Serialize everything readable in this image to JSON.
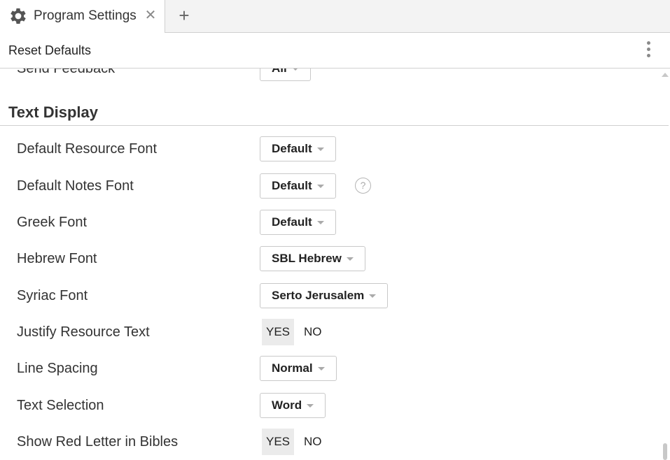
{
  "tab": {
    "title": "Program Settings",
    "close_symbol": "✕",
    "gear_icon": "gear-icon",
    "new_tab_symbol": "+"
  },
  "toolbar": {
    "reset_label": "Reset Defaults",
    "more_icon": "more-vertical-icon"
  },
  "partial_row": {
    "label": "Send Feedback",
    "value": "All"
  },
  "section": {
    "title": "Text Display"
  },
  "settings": [
    {
      "label": "Default Resource Font",
      "type": "dropdown",
      "value": "Default"
    },
    {
      "label": "Default Notes Font",
      "type": "dropdown",
      "value": "Default",
      "help": "?"
    },
    {
      "label": "Greek Font",
      "type": "dropdown",
      "value": "Default"
    },
    {
      "label": "Hebrew Font",
      "type": "dropdown",
      "value": "SBL Hebrew"
    },
    {
      "label": "Syriac Font",
      "type": "dropdown",
      "value": "Serto Jerusalem"
    },
    {
      "label": "Justify Resource Text",
      "type": "toggle",
      "yes": "YES",
      "no": "NO",
      "selected": "YES"
    },
    {
      "label": "Line Spacing",
      "type": "dropdown",
      "value": "Normal"
    },
    {
      "label": "Text Selection",
      "type": "dropdown",
      "value": "Word"
    },
    {
      "label": "Show Red Letter in Bibles",
      "type": "toggle",
      "yes": "YES",
      "no": "NO",
      "selected": "YES"
    }
  ],
  "colors": {
    "background": "#ffffff",
    "tabbar_bg": "#f3f3f3",
    "border": "#d0d0d0",
    "toggle_active_bg": "#ebebeb",
    "text": "#333333"
  }
}
